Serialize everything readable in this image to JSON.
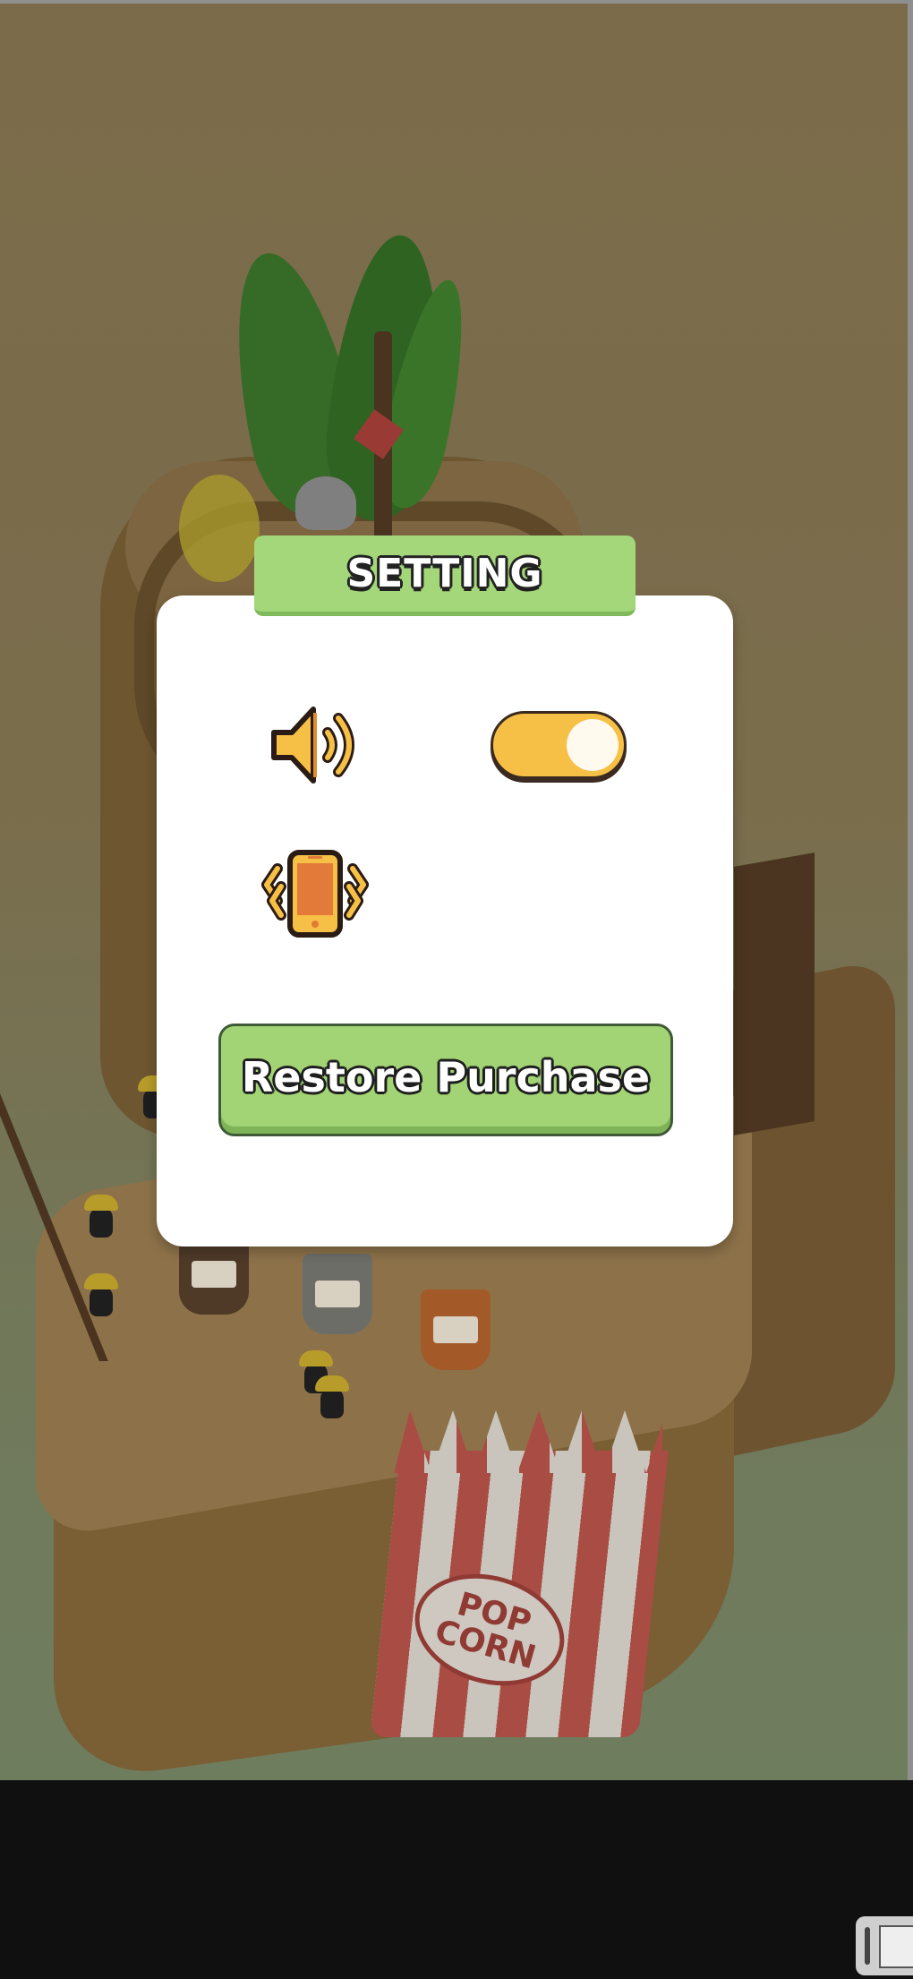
{
  "dialog": {
    "title": "SETTING",
    "settings": [
      {
        "icon": "speaker-icon",
        "toggle": true,
        "toggle_state": "on"
      },
      {
        "icon": "phone-vibrate-icon"
      }
    ],
    "restore_label": "Restore Purchase"
  },
  "scene": {
    "popcorn_label_line1": "POP",
    "popcorn_label_line2": "CORN"
  },
  "colors": {
    "title_tab": "#a3d77a",
    "toggle_on": "#f6bf45",
    "restore_button": "#a2d475",
    "dialog_bg": "#ffffff",
    "scene_tint": "#7a6d4c"
  }
}
